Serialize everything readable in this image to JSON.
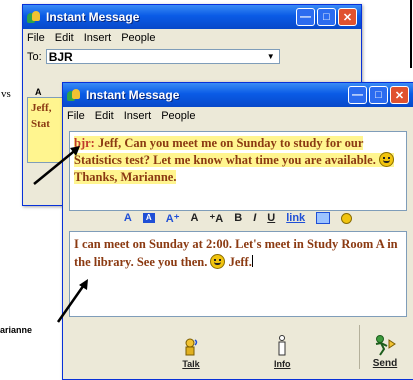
{
  "side_text": {
    "upper_snippet": "vs",
    "lower_snippet": "arianne"
  },
  "back_window": {
    "title": "Instant Message",
    "menu": [
      "File",
      "Edit",
      "Insert",
      "People"
    ],
    "to_label": "To:",
    "to_value": "BJR",
    "tab_letter": "A",
    "snippet_line1": "Jeff,",
    "snippet_line2": "Stat"
  },
  "front_window": {
    "title": "Instant Message",
    "menu": [
      "File",
      "Edit",
      "Insert",
      "People"
    ],
    "received": {
      "sender": "bjr",
      "message": "Jeff, Can you meet me on Sunday to study for our Statistics test? Let me know what time you are available.",
      "signoff": "Thanks, Marianne."
    },
    "format_bar": {
      "items": [
        "A",
        "A",
        "A⁺",
        "A",
        "⁺A",
        "B",
        "I",
        "U",
        "link"
      ]
    },
    "compose": {
      "text": "I can meet on Sunday at 2:00. Let's meet in Study Room A in the library. See you then.",
      "signoff": "Jeff."
    },
    "buttons": {
      "talk": "Talk",
      "info": "Info",
      "send": "Send"
    }
  },
  "colors": {
    "titlebar": "#0a5be6",
    "message_text": "#8b3a12",
    "highlight": "#fff58f"
  }
}
